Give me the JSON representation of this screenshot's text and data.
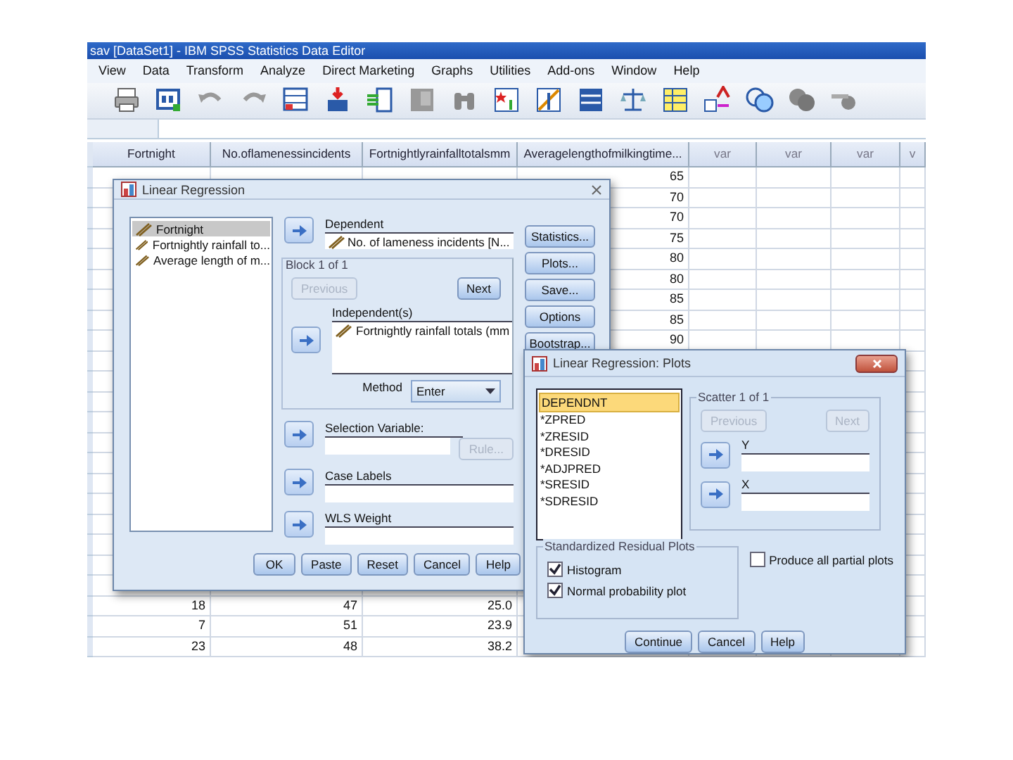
{
  "window": {
    "title": "sav [DataSet1] - IBM SPSS Statistics Data Editor"
  },
  "menu": [
    "View",
    "Data",
    "Transform",
    "Analyze",
    "Direct Marketing",
    "Graphs",
    "Utilities",
    "Add-ons",
    "Window",
    "Help"
  ],
  "grid": {
    "columns": [
      "Fortnight",
      "No.oflamenessincidents",
      "Fortnightlyrainfalltotalsmm",
      "Averagelengthofmilkingtime...",
      "var",
      "var",
      "var",
      "v"
    ],
    "rows": [
      {
        "cells": [
          null,
          null,
          null,
          "65"
        ]
      },
      {
        "cells": [
          null,
          null,
          null,
          "70"
        ]
      },
      {
        "cells": [
          null,
          null,
          null,
          "70"
        ]
      },
      {
        "cells": [
          null,
          null,
          null,
          "75"
        ]
      },
      {
        "cells": [
          null,
          null,
          null,
          "80"
        ]
      },
      {
        "cells": [
          null,
          null,
          null,
          "80"
        ]
      },
      {
        "cells": [
          null,
          null,
          null,
          "85"
        ]
      },
      {
        "cells": [
          null,
          null,
          null,
          "85"
        ]
      },
      {
        "cells": [
          null,
          null,
          null,
          "90"
        ]
      },
      {
        "cells": [
          null,
          null,
          null,
          null
        ]
      },
      {
        "cells": [
          null,
          null,
          null,
          null
        ]
      },
      {
        "cells": [
          null,
          null,
          null,
          null
        ]
      },
      {
        "cells": [
          null,
          null,
          null,
          null
        ]
      },
      {
        "cells": [
          null,
          null,
          null,
          null
        ]
      },
      {
        "cells": [
          null,
          null,
          null,
          null
        ]
      },
      {
        "cells": [
          null,
          null,
          null,
          null
        ]
      },
      {
        "cells": [
          null,
          null,
          null,
          null
        ]
      },
      {
        "cells": [
          null,
          null,
          null,
          null
        ]
      },
      {
        "cells": [
          null,
          null,
          null,
          null
        ]
      },
      {
        "cells": [
          null,
          null,
          null,
          null
        ]
      },
      {
        "cells": [
          null,
          null,
          null,
          null
        ]
      },
      {
        "cells": [
          "18",
          "47",
          "25.0",
          null
        ]
      },
      {
        "cells": [
          "7",
          "51",
          "23.9",
          null
        ]
      },
      {
        "cells": [
          "23",
          "48",
          "38.2",
          null
        ]
      }
    ]
  },
  "regression": {
    "title": "Linear Regression",
    "variables": [
      {
        "label": "Fortnight",
        "selected": true
      },
      {
        "label": "Fortnightly rainfall to...",
        "selected": false
      },
      {
        "label": "Average length of m...",
        "selected": false
      }
    ],
    "dependent_label": "Dependent",
    "dependent_value": "No. of lameness incidents [N...",
    "block_title": "Block 1 of 1",
    "previous": {
      "label": "Previous",
      "disabled": true
    },
    "next": {
      "label": "Next",
      "disabled": false
    },
    "independents_label": "Independent(s)",
    "independents": [
      "Fortnightly rainfall totals (mm"
    ],
    "method_label": "Method",
    "method_value": "Enter",
    "selection_label": "Selection Variable:",
    "rule": {
      "label": "Rule...",
      "disabled": true
    },
    "case_labels_label": "Case Labels",
    "wls_label": "WLS Weight",
    "side_buttons": [
      "Statistics...",
      "Plots...",
      "Save...",
      "Options",
      "Bootstrap..."
    ],
    "footer_buttons": [
      "OK",
      "Paste",
      "Reset",
      "Cancel",
      "Help"
    ]
  },
  "plots": {
    "title": "Linear Regression: Plots",
    "variables": [
      {
        "label": "DEPENDNT",
        "selected": true
      },
      {
        "label": "*ZPRED",
        "selected": false
      },
      {
        "label": "*ZRESID",
        "selected": false
      },
      {
        "label": "*DRESID",
        "selected": false
      },
      {
        "label": "*ADJPRED",
        "selected": false
      },
      {
        "label": "*SRESID",
        "selected": false
      },
      {
        "label": "*SDRESID",
        "selected": false
      }
    ],
    "scatter_title": "Scatter 1 of 1",
    "previous": {
      "label": "Previous",
      "disabled": true
    },
    "next": {
      "label": "Next",
      "disabled": true
    },
    "y_label": "Y",
    "x_label": "X",
    "residual_title": "Standardized Residual Plots",
    "residual_options": [
      {
        "label": "Histogram",
        "checked": true
      },
      {
        "label": "Normal probability plot",
        "checked": true
      }
    ],
    "partial": {
      "label": "Produce all partial plots",
      "checked": false
    },
    "buttons": [
      "Continue",
      "Cancel",
      "Help"
    ]
  }
}
